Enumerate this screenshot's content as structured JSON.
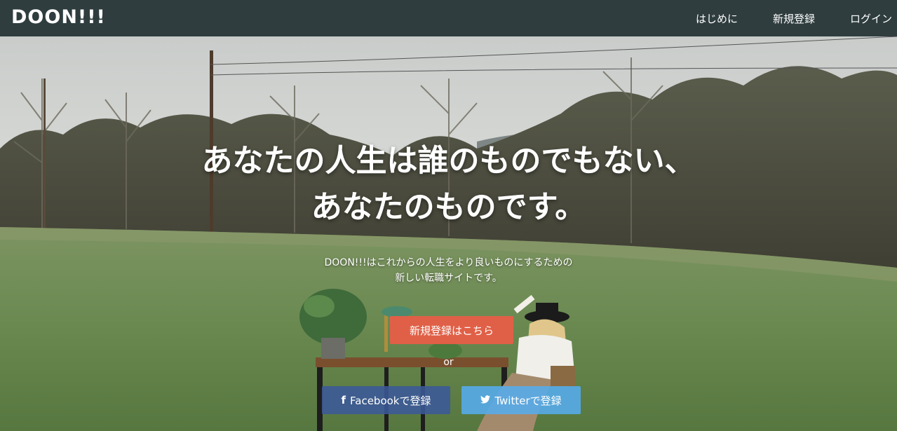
{
  "header": {
    "logo": "DOON!!!",
    "nav": [
      {
        "label": "はじめに"
      },
      {
        "label": "新規登録"
      },
      {
        "label": "ログイン"
      }
    ]
  },
  "hero": {
    "headline_line1": "あなたの人生は誰のものでもない、",
    "headline_line2": "あなたのものです。",
    "subtext_line1": "DOON!!!はこれからの人生をより良いものにするための",
    "subtext_line2": "新しい転職サイトです。",
    "signup_button": "新規登録はこちら",
    "or_text": "or",
    "facebook_button": "Facebookで登録",
    "twitter_button": "Twitterで登録"
  },
  "colors": {
    "header_bg": "#2f3d3f",
    "signup_button": "#ea5c46",
    "facebook_button": "#3b5998",
    "twitter_button": "#55acee"
  },
  "icons": {
    "facebook": "facebook-icon",
    "twitter": "twitter-icon"
  }
}
